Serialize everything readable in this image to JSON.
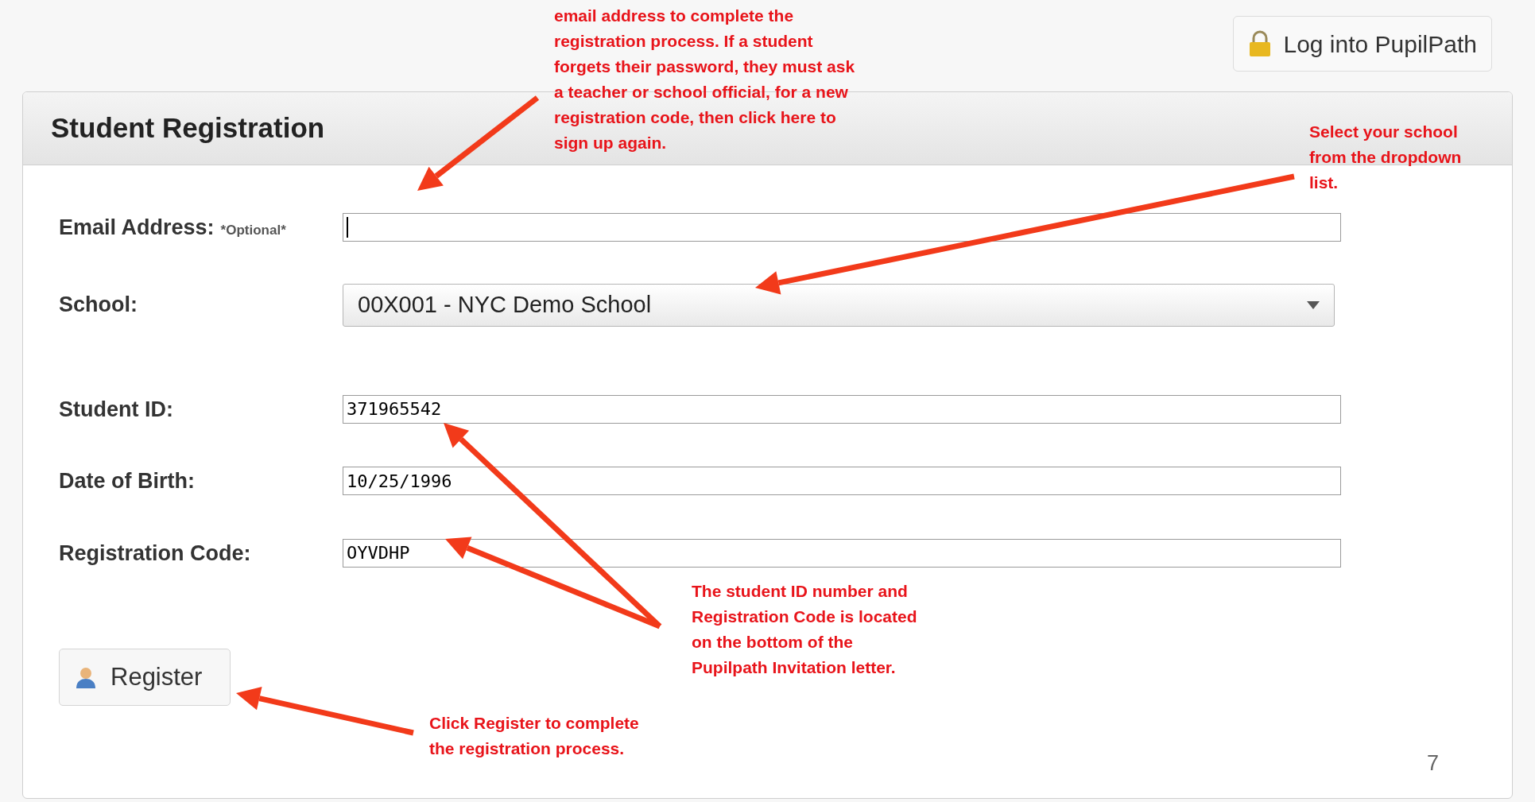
{
  "login_button": {
    "label": "Log into PupilPath"
  },
  "panel": {
    "title": "Student Registration"
  },
  "fields": [
    {
      "kind": "text",
      "label": "Email Address:",
      "hint": "*Optional*",
      "focused": true
    },
    {
      "kind": "select",
      "label": "School:",
      "value": "00X001 - NYC Demo School"
    },
    {
      "kind": "text",
      "label": "Student ID:",
      "value": "371965542",
      "focused": false
    },
    {
      "kind": "text",
      "label": "Date of Birth:",
      "value": "10/25/1996",
      "focused": false
    },
    {
      "kind": "text",
      "label": "Registration Code:",
      "value": "OYVDHP",
      "focused": false
    }
  ],
  "register_button": {
    "label": "Register"
  },
  "annotations": [
    {
      "lines": [
        "email address to complete the",
        "registration process.  If a student",
        "forgets their password, they must ask",
        "a teacher or school official, for a new",
        "registration code, then click here to",
        "sign up again."
      ]
    },
    {
      "lines": [
        "Select your school",
        "from the dropdown",
        "list."
      ]
    },
    {
      "lines": [
        "The student ID number and",
        "Registration Code is located",
        "on the bottom of the",
        "Pupilpath Invitation letter."
      ]
    },
    {
      "lines": [
        "Click Register to complete",
        "the registration process."
      ]
    }
  ],
  "page_number": "7"
}
